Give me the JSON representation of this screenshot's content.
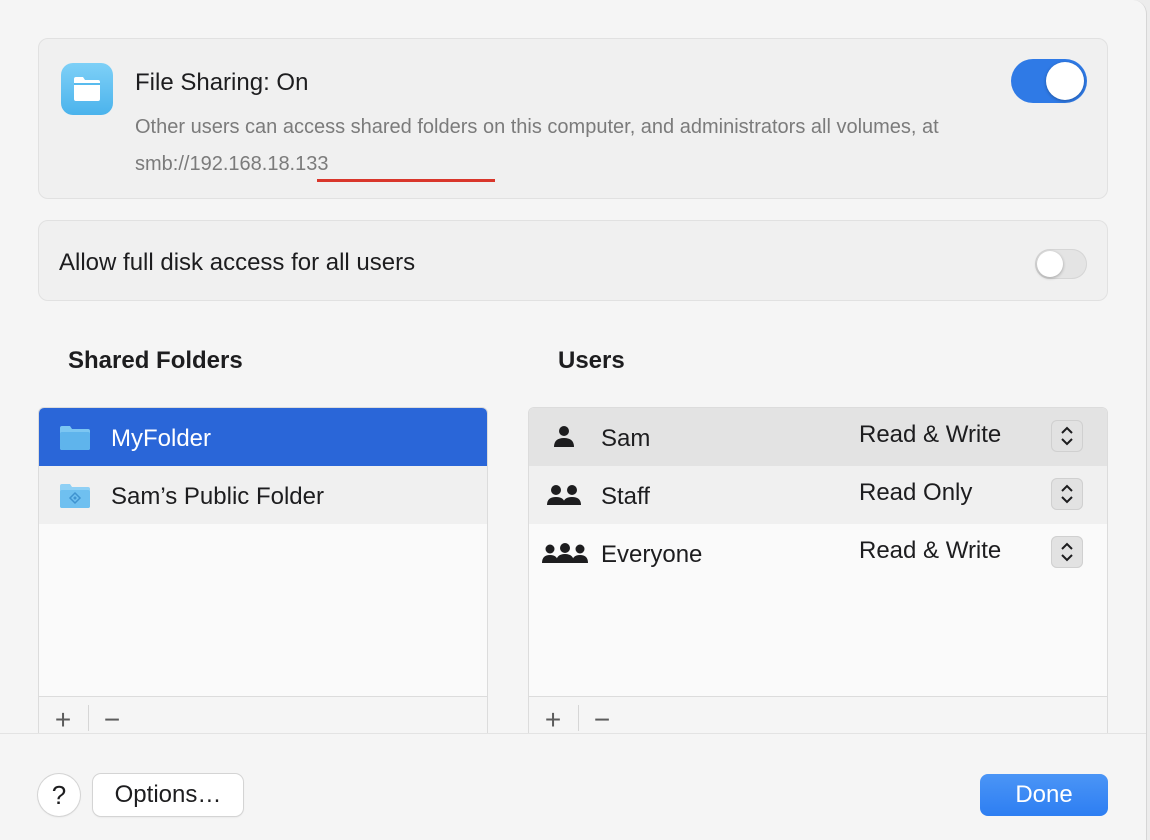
{
  "sharing": {
    "title": "File Sharing: On",
    "description_prefix": "Other users can access shared folders on this computer, and administrators all volumes, at smb:/",
    "address": "/192.168.18.133",
    "enabled": true,
    "icon": "folder-icon"
  },
  "disk_access": {
    "label": "Allow full disk access for all users",
    "enabled": false
  },
  "shared_folders": {
    "title": "Shared Folders",
    "items": [
      {
        "label": "MyFolder",
        "selected": true,
        "icon": "folder-icon"
      },
      {
        "label": "Sam’s Public Folder",
        "selected": false,
        "icon": "public-folder-icon"
      }
    ],
    "add_label": "+",
    "remove_label": "−"
  },
  "users": {
    "title": "Users",
    "items": [
      {
        "name": "Sam",
        "permission": "Read & Write",
        "icon": "person-icon"
      },
      {
        "name": "Staff",
        "permission": "Read Only",
        "icon": "group-icon"
      },
      {
        "name": "Everyone",
        "permission": "Read & Write",
        "icon": "everyone-icon"
      }
    ],
    "add_label": "+",
    "remove_label": "−"
  },
  "footer": {
    "help_label": "?",
    "options_label": "Options…",
    "done_label": "Done"
  },
  "colors": {
    "accent": "#2f7ae6",
    "selection": "#2a66d8",
    "underline": "#d9362b"
  }
}
